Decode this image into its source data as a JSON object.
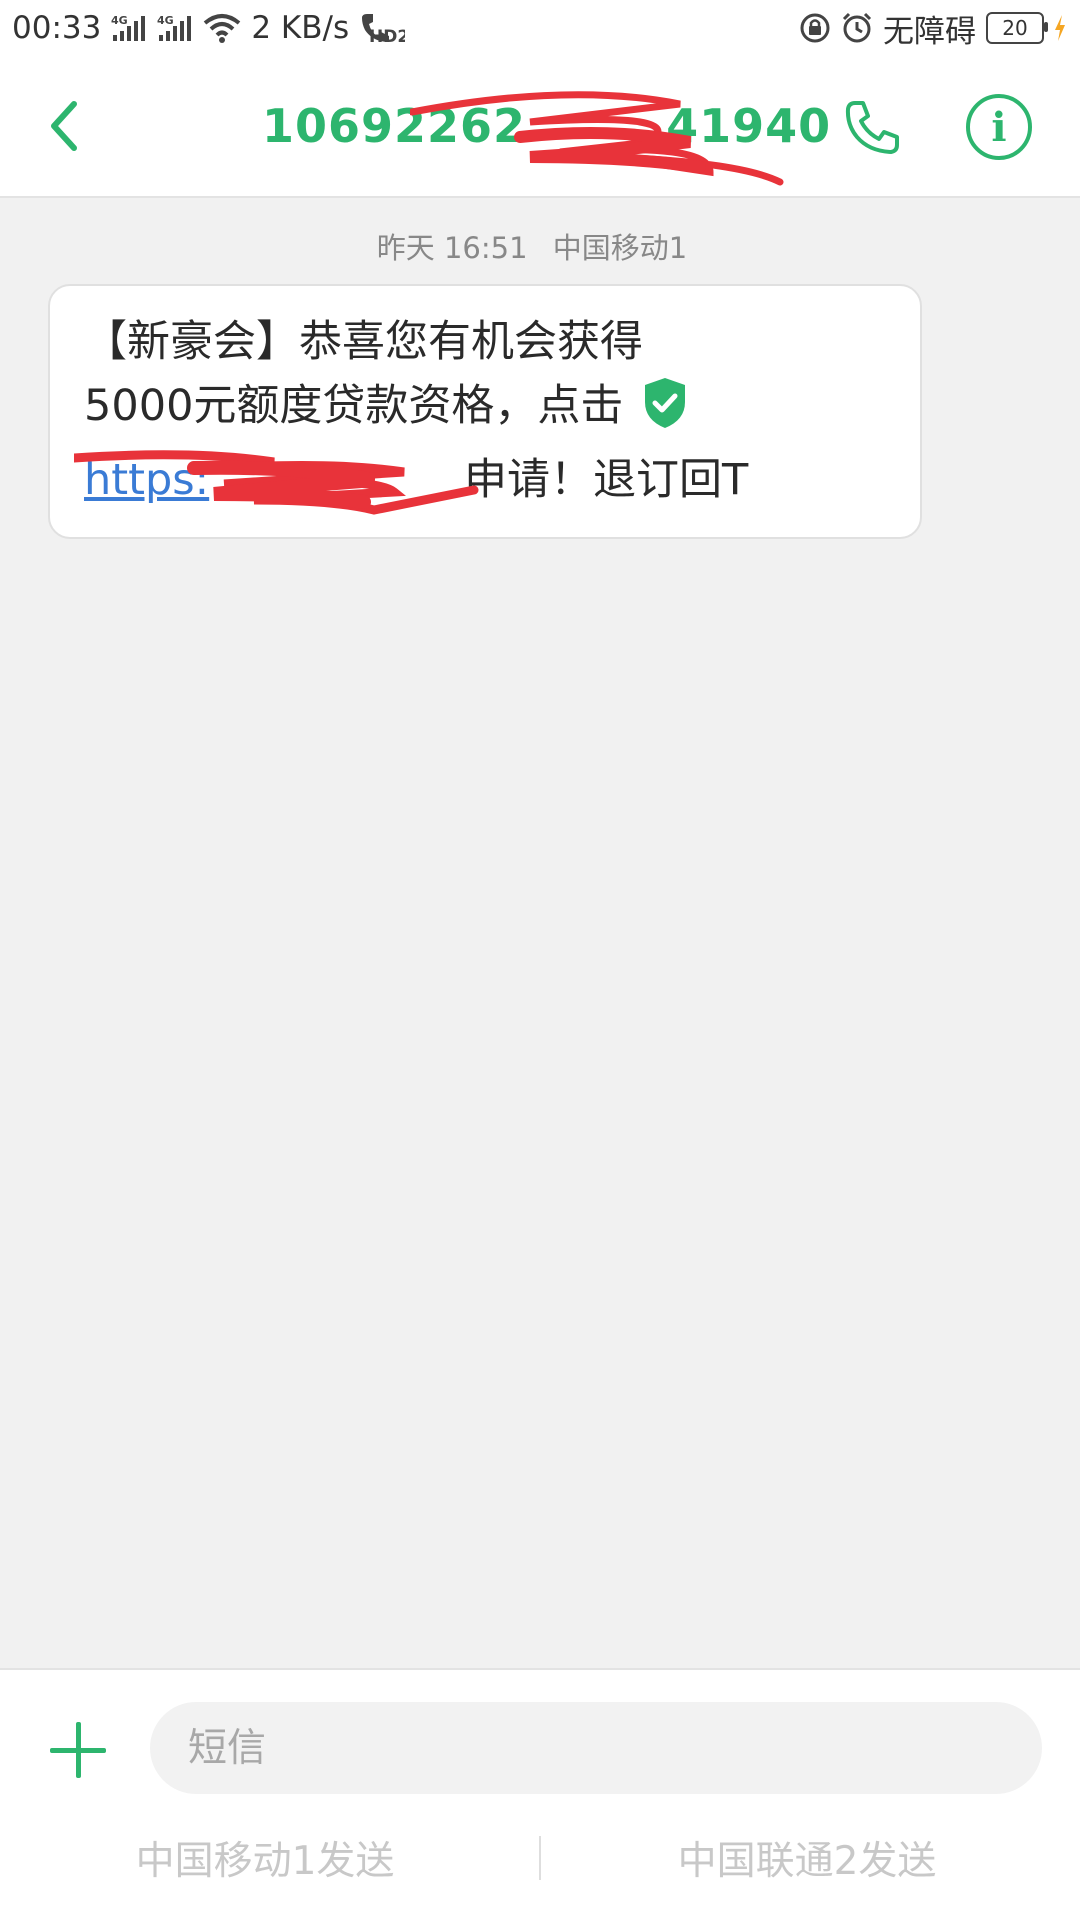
{
  "status_bar": {
    "time": "00:33",
    "network_1": "4G",
    "network_2": "4G",
    "speed": "2 KB/s",
    "hd_label": "HD2",
    "accessibility": "无障碍",
    "battery": "20",
    "icons": [
      "signal-icon",
      "signal-icon",
      "wifi-icon",
      "hd-call-icon",
      "lock-rotate-icon",
      "alarm-icon",
      "battery-icon",
      "charging-icon"
    ]
  },
  "header": {
    "number_start": "10692262",
    "number_end": "41940",
    "accent_color": "#2db56e",
    "icons": [
      "back-icon",
      "phone-icon",
      "info-icon"
    ]
  },
  "conversation": {
    "timestamp": "昨天 16:51",
    "sim_label": "中国移动1",
    "message": {
      "line1": "【新豪会】恭喜您有机会获得",
      "line2": "5000元额度贷款资格，点击",
      "link_text": "https:",
      "line3_after_link": "申请！退订回T"
    }
  },
  "composer": {
    "placeholder": "短信",
    "send_sim1": "中国移动1发送",
    "send_sim2": "中国联通2发送"
  }
}
